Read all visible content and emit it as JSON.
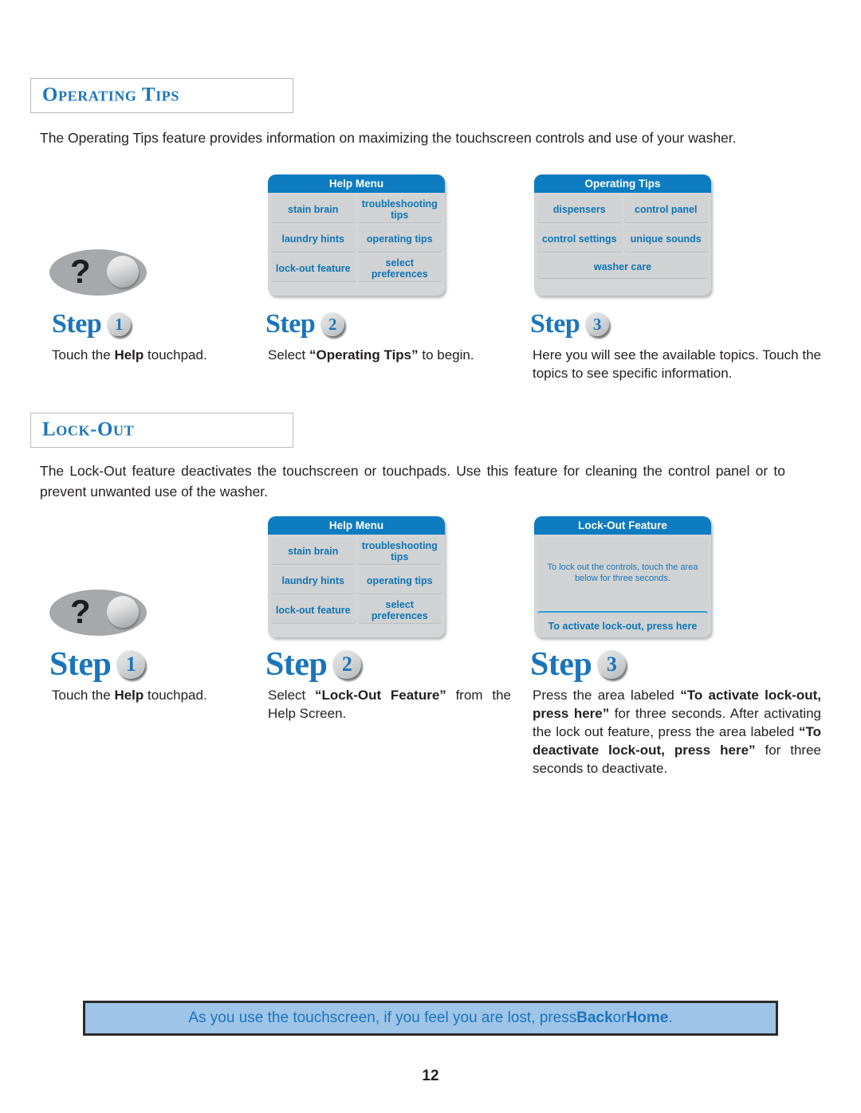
{
  "sections": [
    {
      "heading": "Operating Tips",
      "intro": "The Operating Tips feature provides information on maximizing the touchscreen controls and use of your washer.",
      "steps": [
        {
          "word": "Step",
          "number": "1",
          "caption_before": "Touch the ",
          "caption_bold": "Help",
          "caption_after": " touchpad."
        },
        {
          "word": "Step",
          "number": "2",
          "caption_before": "Select ",
          "caption_bold": "“Operating Tips”",
          "caption_after": " to begin."
        },
        {
          "word": "Step",
          "number": "3",
          "caption_before": "Here you will see the available topics.  Touch the topics to see specific information.",
          "caption_bold": "",
          "caption_after": ""
        }
      ]
    },
    {
      "heading": "Lock-Out",
      "intro": "The Lock-Out feature deactivates the touchscreen or touchpads.  Use this feature for cleaning the control panel or to prevent unwanted use of the washer.",
      "steps": [
        {
          "word": "Step",
          "number": "1",
          "caption_before": "Touch the ",
          "caption_bold": "Help",
          "caption_after": " touchpad."
        },
        {
          "word": "Step",
          "number": "2",
          "caption_before": "Select ",
          "caption_bold": "“Lock-Out Feature”",
          "caption_after": " from the Help Screen."
        },
        {
          "word": "Step",
          "number": "3",
          "caption_before": "Press the area labeled ",
          "caption_bold": "“To activate lock-out, press here”",
          "caption_mid": " for three seconds.  After activating the lock out feature, press the area labeled ",
          "caption_bold2": "“To deactivate lock-out, press here”",
          "caption_after": " for three seconds to deactivate."
        }
      ]
    }
  ],
  "touchpad": {
    "symbol": "?"
  },
  "help_menu_panel": {
    "header": "Help Menu",
    "buttons": [
      "stain brain",
      "troubleshooting tips",
      "laundry hints",
      "operating tips",
      "lock-out feature",
      "select preferences"
    ]
  },
  "operating_tips_panel": {
    "header": "Operating Tips",
    "buttons": [
      "dispensers",
      "control panel",
      "control settings",
      "unique sounds"
    ],
    "full_button": "washer care"
  },
  "lockout_panel": {
    "header": "Lock-Out Feature",
    "body": "To lock out the controls, touch the area below for three seconds.",
    "action": "To activate lock-out, press here"
  },
  "callout": {
    "before": "As you use the touchscreen, if you feel you are lost, press ",
    "bold1": "Back",
    "mid": " or ",
    "bold2": "Home",
    "after": "."
  },
  "page_number": "12",
  "colors": {
    "brand_blue": "#1a75bb",
    "panel_header_blue": "#0d7cc0",
    "panel_gray": "#d3d5d6",
    "callout_bg": "#9ec4e8"
  }
}
